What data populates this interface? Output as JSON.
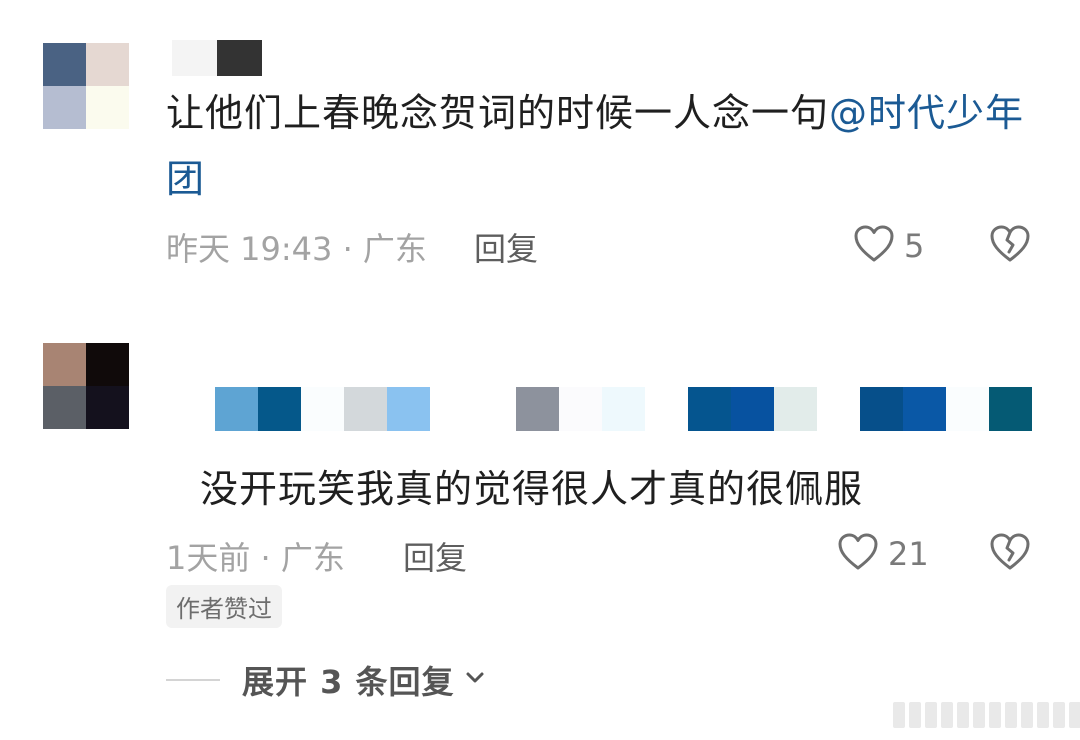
{
  "comments": [
    {
      "avatar_colors": [
        "#4a6283",
        "#e5d8d2",
        "#b5bdd1",
        "#fbfbee"
      ],
      "username_colors": [
        "#f4f4f4",
        "#333333"
      ],
      "text": "让他们上春晚念贺词的时候一人念一句",
      "mention": "@时代少年团",
      "time_location": "昨天 19:43 · 广东",
      "reply_label": "回复",
      "like_count": "5",
      "author_liked": null
    },
    {
      "avatar_colors": [
        "#a88473",
        "#100a0a",
        "#5b5f66",
        "#14111d"
      ],
      "username_colors": [
        "#5ea4d3",
        "#05588a",
        "#fafdfe",
        "#d3d8db",
        "#8ac2f0",
        "#ffffff",
        "#ffffff",
        "#8d929d",
        "#fbfbfd",
        "#eef9fd",
        "#ffffff",
        "#05558f",
        "#0752a0",
        "#e2ecea",
        "#ffffff",
        "#064f8a",
        "#0a58a6",
        "#fafdfe",
        "#055a74"
      ],
      "text": "没开玩笑我真的觉得很人才真的很佩服",
      "time_location": "1天前 · 广东",
      "reply_label": "回复",
      "like_count": "21",
      "author_liked": "作者赞过",
      "expand_label": "展开 3 条回复"
    }
  ]
}
